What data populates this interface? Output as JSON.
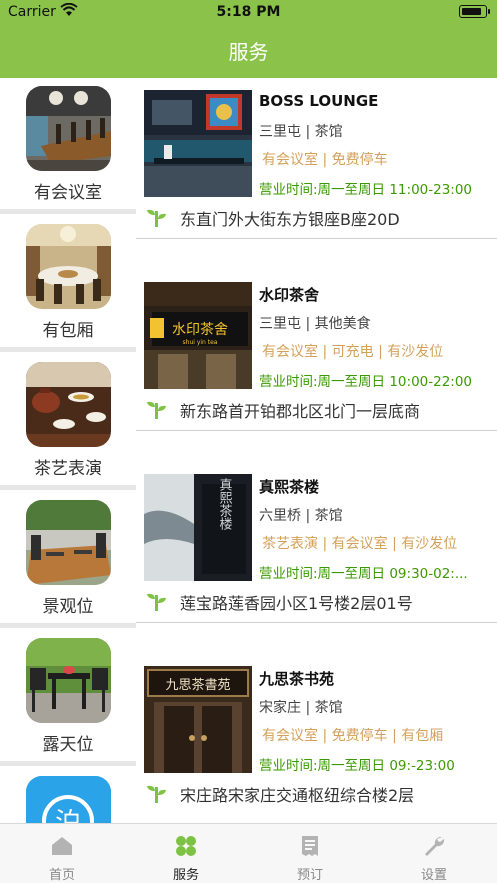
{
  "status_bar": {
    "carrier": "Carrier",
    "time": "5:18 PM",
    "battery_level": 0.9
  },
  "nav": {
    "title": "服务"
  },
  "categories": [
    {
      "label": "有会议室",
      "icon": "meeting-room-photo"
    },
    {
      "label": "有包厢",
      "icon": "private-room-photo"
    },
    {
      "label": "茶艺表演",
      "icon": "tea-ceremony-photo"
    },
    {
      "label": "景观位",
      "icon": "scenic-seat-photo"
    },
    {
      "label": "露天位",
      "icon": "outdoor-seat-photo"
    },
    {
      "label": "",
      "icon": "parking-app-icon"
    }
  ],
  "shops": [
    {
      "name": "BOSS LOUNGE",
      "area": "三里屯 | 茶馆",
      "tags": "有会议室 | 免费停车",
      "hours": "营业时间:周一至周日 11:00-23:00",
      "address": "东直门外大街东方银座B座20D"
    },
    {
      "name": "水印茶舍",
      "area": "三里屯 | 其他美食",
      "tags": "有会议室 | 可充电 | 有沙发位",
      "hours": "营业时间:周一至周日 10:00-22:00",
      "address": "新东路首开铂郡北区北门一层底商"
    },
    {
      "name": "真熙茶楼",
      "area": "六里桥 | 茶馆",
      "tags": "茶艺表演 | 有会议室 | 有沙发位",
      "hours": "营业时间:周一至周日 09:30-02:...",
      "address": "莲宝路莲香园小区1号楼2层01号"
    },
    {
      "name": "九思茶书苑",
      "area": "宋家庄 | 茶馆",
      "tags": "有会议室 | 免费停车 | 有包厢",
      "hours": "营业时间:周一至周日 09:-23:00",
      "address": "宋庄路宋家庄交通枢纽综合楼2层"
    }
  ],
  "shop_images": {
    "sign_1": "水印茶舍",
    "sign_1_sub": "shui yin tea",
    "sign_2": "真熙茶楼",
    "sign_3": "九思茶書苑"
  },
  "tabbar": [
    {
      "label": "首页",
      "icon": "home-icon",
      "active": false
    },
    {
      "label": "服务",
      "icon": "clover-icon",
      "active": true
    },
    {
      "label": "预订",
      "icon": "receipt-icon",
      "active": false
    },
    {
      "label": "设置",
      "icon": "wrench-icon",
      "active": false
    }
  ],
  "colors": {
    "brand_green": "#8bc34a",
    "tag_gold": "#d4a05a",
    "hours_green": "#3c9a00"
  }
}
